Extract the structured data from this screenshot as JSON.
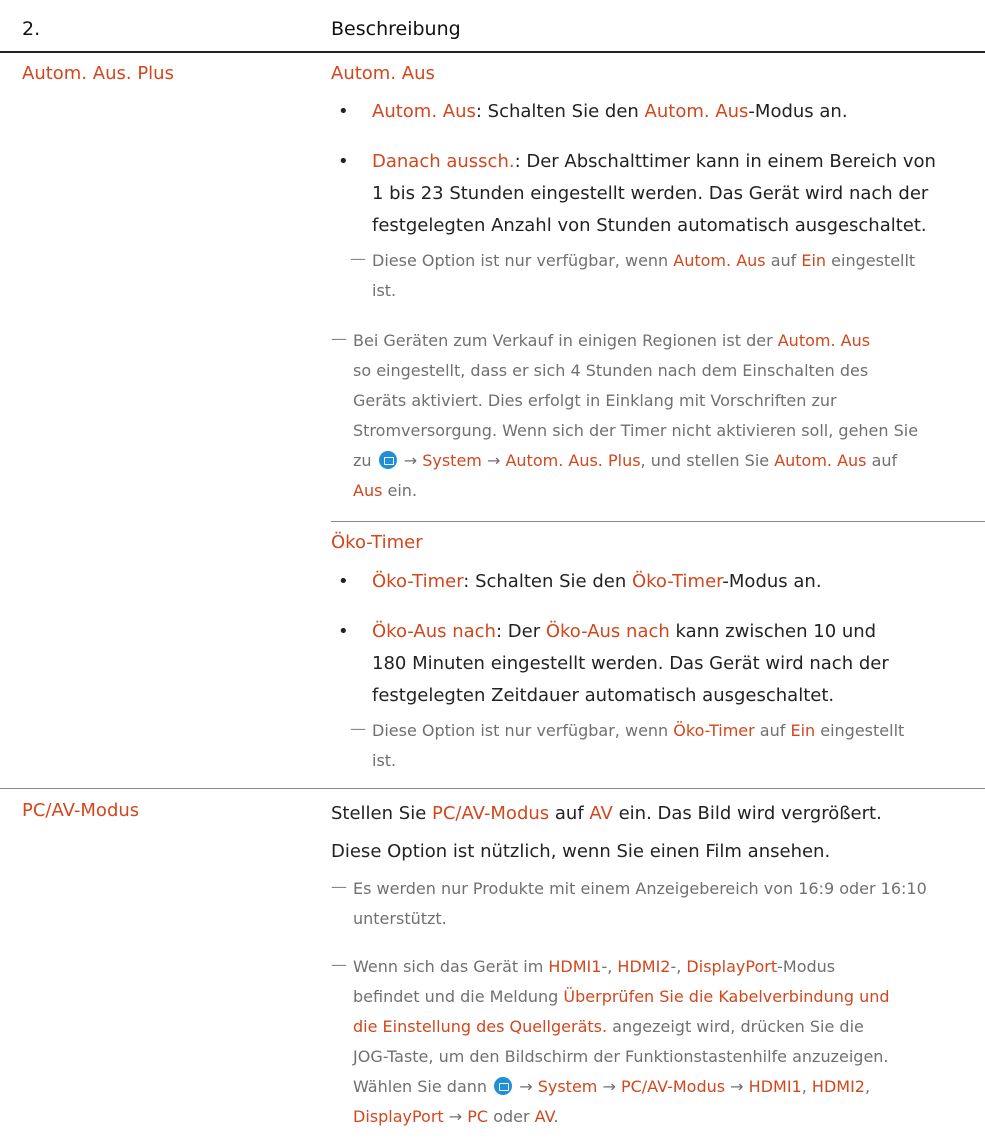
{
  "header": {
    "col1": "2.",
    "col2": "Beschreibung"
  },
  "auto_off": {
    "label": "Autom. Aus. Plus",
    "section_title": "Autom. Aus",
    "b1_term": "Autom. Aus",
    "b1_pre": ": Schalten Sie den ",
    "b1_term2": "Autom. Aus",
    "b1_post": "-Modus an.",
    "b2_term": "Danach aussch.",
    "b2_line1": ": Der Abschalttimer kann in einem Bereich von",
    "b2_line2": "1 bis 23 Stunden eingestellt werden. Das Gerät wird nach der",
    "b2_line3": "festgelegten Anzahl von Stunden automatisch ausgeschaltet.",
    "note1_pre": "Diese Option ist nur verfügbar, wenn ",
    "note1_term": "Autom. Aus",
    "note1_mid": " auf ",
    "note1_term2": "Ein",
    "note1_post": " eingestellt",
    "note1_line2": "ist.",
    "note2_pre": "Bei Geräten zum Verkauf in einigen Regionen ist der ",
    "note2_term": "Autom. Aus",
    "note2_line2": "so eingestellt, dass er sich 4 Stunden nach dem Einschalten des",
    "note2_line3": "Geräts aktiviert. Dies erfolgt in Einklang mit Vorschriften zur",
    "note2_line4": "Stromversorgung. Wenn sich der Timer nicht aktivieren soll, gehen Sie",
    "note2_zu": "zu",
    "note2_arrow1": " → ",
    "note2_system": "System",
    "note2_arrow2": " → ",
    "note2_plus": "Autom. Aus. Plus",
    "note2_mid": ", und stellen Sie ",
    "note2_term3": "Autom. Aus",
    "note2_auf": " auf",
    "note2_aus": "Aus",
    "note2_ein": " ein."
  },
  "eco": {
    "section_title": "Öko-Timer",
    "b1_term": "Öko-Timer",
    "b1_pre": ": Schalten Sie den ",
    "b1_term2": "Öko-Timer",
    "b1_post": "-Modus an.",
    "b2_term": "Öko-Aus nach",
    "b2_pre": ": Der ",
    "b2_term2": "Öko-Aus nach",
    "b2_post": " kann zwischen 10 und",
    "b2_line2": "180 Minuten eingestellt werden. Das Gerät wird nach der",
    "b2_line3": "festgelegten Zeitdauer automatisch ausgeschaltet.",
    "note_pre": "Diese Option ist nur verfügbar, wenn ",
    "note_term": "Öko-Timer",
    "note_mid": " auf ",
    "note_term2": "Ein",
    "note_post": " eingestellt",
    "note_line2": "ist."
  },
  "pcav": {
    "label": "PC/AV-Modus",
    "p1_pre": "Stellen Sie ",
    "p1_term": "PC/AV-Modus",
    "p1_mid": " auf ",
    "p1_term2": "AV",
    "p1_post": " ein. Das Bild wird vergrößert.",
    "p2": "Diese Option ist nützlich, wenn Sie einen Film ansehen.",
    "note1_line1": "Es werden nur Produkte mit einem Anzeigebereich von 16:9 oder 16:10",
    "note1_line2": "unterstützt.",
    "note2_pre": "Wenn sich das Gerät im ",
    "note2_hdmi1": "HDMI1",
    "note2_sep1": "-, ",
    "note2_hdmi2": "HDMI2",
    "note2_sep2": "-, ",
    "note2_dp": "DisplayPort",
    "note2_post": "-Modus",
    "note2_line2_pre": "befindet und die Meldung ",
    "note2_msg1": "Überprüfen Sie die Kabelverbindung und",
    "note2_msg2": "die Einstellung des Quellgeräts.",
    "note2_line3_post": " angezeigt wird, drücken Sie die",
    "note2_line4": "JOG-Taste, um den Bildschirm der Funktionstastenhilfe anzuzeigen.",
    "note2_line5_pre": "Wählen Sie dann",
    "note2_a1": " → ",
    "note2_system": "System",
    "note2_a2": " → ",
    "note2_mode": "PC/AV-Modus",
    "note2_a3": " → ",
    "note2_h1": "HDMI1",
    "note2_c1": ", ",
    "note2_h2": "HDMI2",
    "note2_c2": ",",
    "note2_dp2": "DisplayPort",
    "note2_a4": " → ",
    "note2_pc": "PC",
    "note2_oder": " oder ",
    "note2_av": "AV",
    "note2_end": "."
  }
}
